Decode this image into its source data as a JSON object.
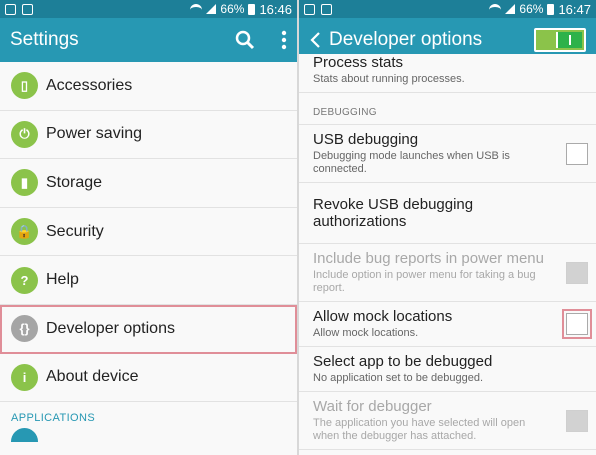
{
  "left": {
    "status": {
      "time": "16:46",
      "battery": "66%"
    },
    "actionbar": {
      "title": "Settings"
    },
    "items": [
      {
        "label": "Accessories",
        "icon": "accessories-icon",
        "glyph": "▯"
      },
      {
        "label": "Power saving",
        "icon": "power-icon",
        "glyph": "⏻"
      },
      {
        "label": "Storage",
        "icon": "storage-icon",
        "glyph": "▮"
      },
      {
        "label": "Security",
        "icon": "lock-icon",
        "glyph": "🔒"
      },
      {
        "label": "Help",
        "icon": "help-icon",
        "glyph": "?"
      },
      {
        "label": "Developer options",
        "icon": "developer-icon",
        "glyph": "{}"
      },
      {
        "label": "About device",
        "icon": "info-icon",
        "glyph": "i"
      }
    ],
    "section": "APPLICATIONS"
  },
  "right": {
    "status": {
      "time": "16:47",
      "battery": "66%"
    },
    "actionbar": {
      "title": "Developer options",
      "toggle_on": true
    },
    "partial_title": "Process stats",
    "partial_sub": "Stats about running processes.",
    "section": "DEBUGGING",
    "rows": [
      {
        "title": "USB debugging",
        "sub": "Debugging mode launches when USB is connected.",
        "checkbox": true,
        "disabled": false
      },
      {
        "title": "Revoke USB debugging authorizations",
        "sub": "",
        "checkbox": false,
        "disabled": false
      },
      {
        "title": "Include bug reports in power menu",
        "sub": "Include option in power menu for taking a bug report.",
        "checkbox": true,
        "disabled": true
      },
      {
        "title": "Allow mock locations",
        "sub": "Allow mock locations.",
        "checkbox": true,
        "disabled": false,
        "highlight": true
      },
      {
        "title": "Select app to be debugged",
        "sub": "No application set to be debugged.",
        "checkbox": false,
        "disabled": false
      },
      {
        "title": "Wait for debugger",
        "sub": "The application you have selected will open when the debugger has attached.",
        "checkbox": true,
        "disabled": true
      }
    ]
  },
  "colors": {
    "statusbar": "#1d7f98",
    "actionbar": "#2798b3",
    "icon_green": "#8bc34a",
    "highlight": "#e08e98"
  }
}
